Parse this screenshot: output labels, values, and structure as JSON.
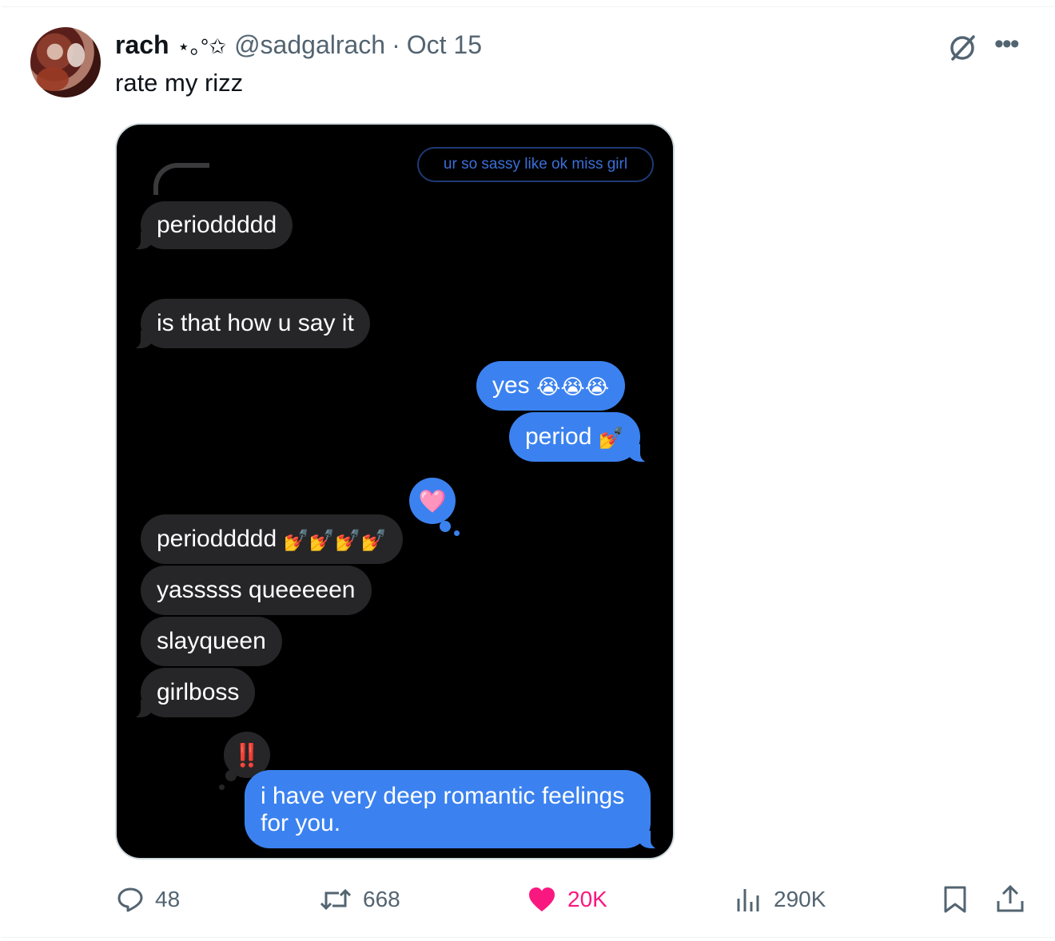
{
  "tweet": {
    "author_name": "rach",
    "author_deco": "⋆｡°✩",
    "handle": "@sadgalrach",
    "separator": "·",
    "date": "Oct 15",
    "text": "rate my rizz"
  },
  "messages": {
    "reply_quote": "ur so sassy like ok miss girl",
    "m1": "perioddddd",
    "m2": "is that how u say it",
    "m3_text": "yes",
    "m3_emoji": "😭😭😭",
    "m4_text": "period",
    "m4_emoji": "💅",
    "m5_text": "perioddddd",
    "m5_emoji": "💅💅💅💅",
    "m5_tapback": "🩷",
    "m6": "yasssss queeeeen",
    "m7": "slayqueen",
    "m8": "girlboss",
    "m9_tapback": "‼️",
    "m9_line1": "i have very deep romantic feelings",
    "m9_line2": "for you."
  },
  "actions": {
    "replies": "48",
    "reposts": "668",
    "likes": "20K",
    "views": "290K"
  },
  "colors": {
    "like_pink": "#f91880",
    "imessage_blue": "#3b82f0",
    "imessage_gray": "#262628",
    "muted_text": "#536471"
  },
  "icons": [
    "grok-icon",
    "more-icon",
    "reply-icon",
    "repost-icon",
    "heart-icon",
    "views-icon",
    "bookmark-icon",
    "share-icon"
  ]
}
